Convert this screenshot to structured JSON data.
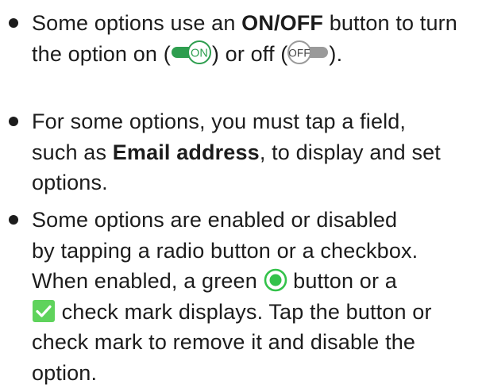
{
  "bullets": [
    {
      "line1_pre": "Some options use an ",
      "line1_bold": "ON/OFF",
      "line1_post": " button to turn",
      "line2_pre": "the option on (",
      "line2_mid": ") or off (",
      "line2_post": ")."
    },
    {
      "line1": "For some options, you must tap a field,",
      "line2_pre": "such as ",
      "line2_bold": "Email address",
      "line2_post": ", to display and set",
      "line3": "options."
    },
    {
      "line1": "Some options are enabled or disabled",
      "line2": "by tapping a radio button or a checkbox.",
      "line3_pre": "When enabled, a green ",
      "line3_post": " button or a",
      "line4_post": " check mark displays. Tap the button or",
      "line5": "check mark to remove it and disable the",
      "line6": "option."
    }
  ],
  "icons": {
    "toggle_on": {
      "name": "toggle-on-icon",
      "label": "ON",
      "color": "#2e9e4f"
    },
    "toggle_off": {
      "name": "toggle-off-icon",
      "label": "OFF",
      "color": "#9a9a9a"
    },
    "radio": {
      "name": "radio-selected-icon",
      "color": "#33c24a"
    },
    "checkbox": {
      "name": "checkbox-checked-icon",
      "color": "#5fd35c"
    }
  }
}
